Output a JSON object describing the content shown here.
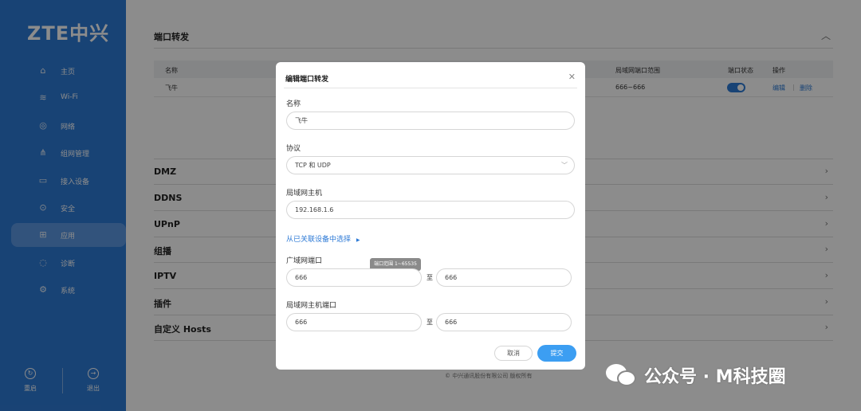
{
  "brand": {
    "logo_text": "ZTE中兴"
  },
  "sidebar": {
    "items": [
      {
        "label": "主页",
        "icon": "home-icon"
      },
      {
        "label": "Wi-Fi",
        "icon": "wifi-icon"
      },
      {
        "label": "网络",
        "icon": "globe-icon"
      },
      {
        "label": "组网管理",
        "icon": "mesh-icon"
      },
      {
        "label": "接入设备",
        "icon": "monitor-icon"
      },
      {
        "label": "安全",
        "icon": "shield-icon"
      },
      {
        "label": "应用",
        "icon": "apps-grid-icon",
        "active": true
      },
      {
        "label": "诊断",
        "icon": "diagnose-icon"
      },
      {
        "label": "系统",
        "icon": "settings-icon"
      }
    ],
    "bottom": {
      "restart_label": "重启",
      "logout_label": "退出"
    }
  },
  "main": {
    "section_title": "端口转发",
    "table": {
      "headers": {
        "name": "名称",
        "lan_range": "局域网端口范围",
        "status": "端口状态",
        "actions": "操作"
      },
      "rows": [
        {
          "name": "飞牛",
          "lan_range": "666~666",
          "enabled": true,
          "edit": "编辑",
          "delete": "删除"
        }
      ]
    },
    "accordion": [
      "DMZ",
      "DDNS",
      "UPnP",
      "组播",
      "IPTV",
      "插件",
      "自定义 Hosts"
    ],
    "copyright": "© 中兴通讯股份有限公司 版权所有"
  },
  "modal": {
    "title": "编辑端口转发",
    "close_icon": "close-icon",
    "name_label": "名称",
    "name_value": "飞牛",
    "protocol_label": "协议",
    "protocol_value": "TCP 和 UDP",
    "lan_host_label": "局域网主机",
    "lan_host_value": "192.168.1.6",
    "choose_link": "从已关联设备中选择",
    "wan_port_label": "广域网端口",
    "wan_port_start": "666",
    "wan_port_end": "666",
    "to_label": "至",
    "tooltip": "端口范围 1~65535",
    "lan_port_label": "局域网主机端口",
    "lan_port_start": "666",
    "lan_port_end": "666",
    "cancel_label": "取消",
    "submit_label": "提交"
  },
  "watermark": {
    "text": "公众号 · M科技圈",
    "icon": "wechat-icon"
  },
  "colors": {
    "sidebar": "#2d7ad6",
    "active_item": "#5b98e2",
    "submit": "#3c9ef2",
    "link": "#2d7ad6"
  }
}
